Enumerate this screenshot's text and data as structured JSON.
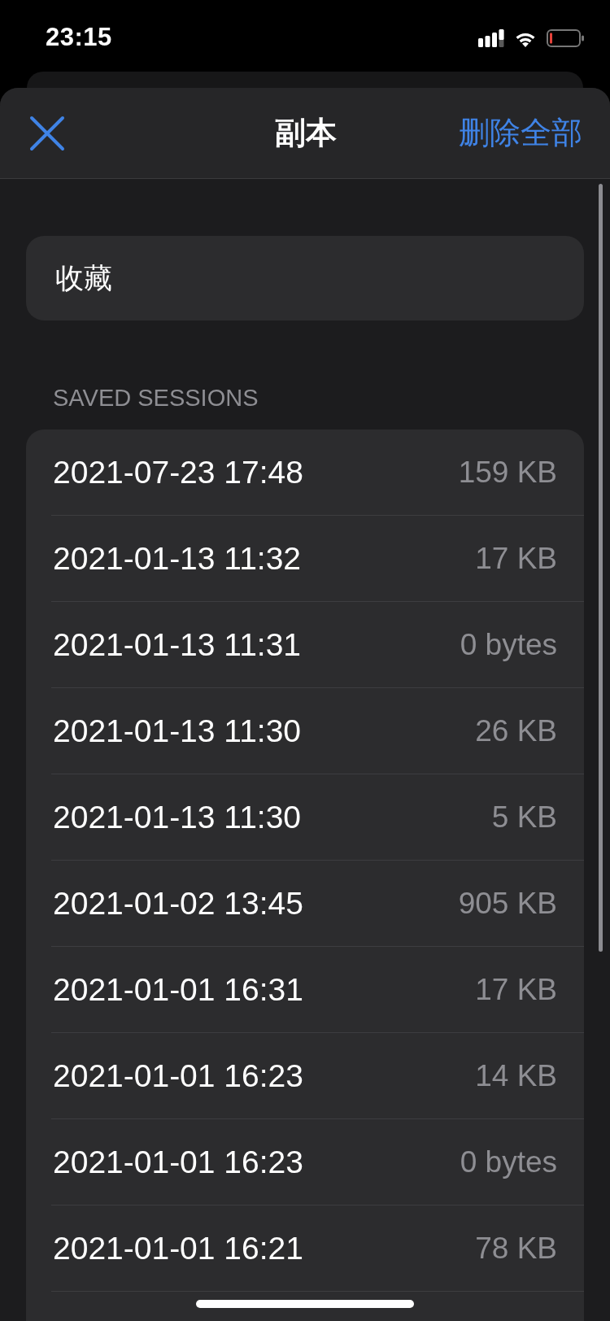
{
  "status_bar": {
    "time": "23:15"
  },
  "header": {
    "title": "副本",
    "action": "删除全部"
  },
  "favorites": {
    "label": "收藏"
  },
  "saved_sessions": {
    "heading": "SAVED SESSIONS",
    "rows": [
      {
        "date": "2021-07-23 17:48",
        "size": "159 KB"
      },
      {
        "date": "2021-01-13 11:32",
        "size": "17 KB"
      },
      {
        "date": "2021-01-13 11:31",
        "size": "0 bytes"
      },
      {
        "date": "2021-01-13 11:30",
        "size": "26 KB"
      },
      {
        "date": "2021-01-13 11:30",
        "size": "5 KB"
      },
      {
        "date": "2021-01-02 13:45",
        "size": "905 KB"
      },
      {
        "date": "2021-01-01 16:31",
        "size": "17 KB"
      },
      {
        "date": "2021-01-01 16:23",
        "size": "14 KB"
      },
      {
        "date": "2021-01-01 16:23",
        "size": "0 bytes"
      },
      {
        "date": "2021-01-01 16:21",
        "size": "78 KB"
      }
    ]
  }
}
